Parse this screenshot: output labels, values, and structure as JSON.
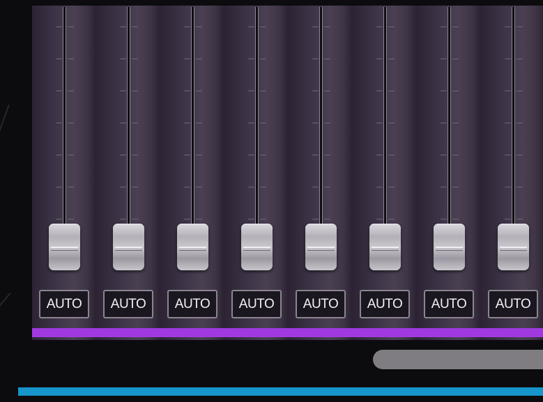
{
  "mixer": {
    "accent_strip_color": "#a03ae0",
    "bottom_bar_color": "#1595c9",
    "channels": [
      {
        "auto_label": "AUTO"
      },
      {
        "auto_label": "AUTO"
      },
      {
        "auto_label": "AUTO"
      },
      {
        "auto_label": "AUTO"
      },
      {
        "auto_label": "AUTO"
      },
      {
        "auto_label": "AUTO"
      },
      {
        "auto_label": "AUTO"
      },
      {
        "auto_label": "AUTO"
      }
    ]
  },
  "icons": {
    "fader": "fader-cap-icon"
  }
}
